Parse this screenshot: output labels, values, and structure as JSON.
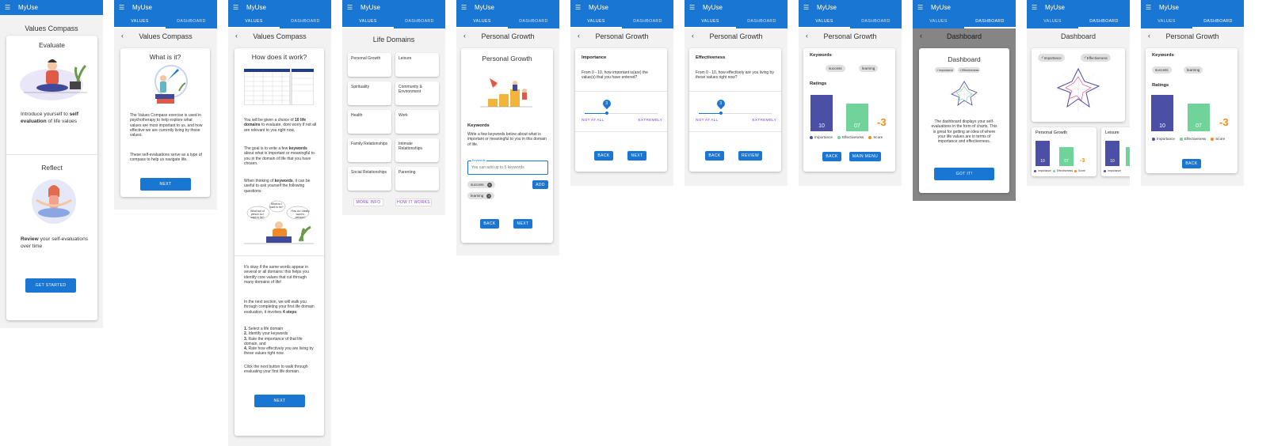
{
  "app_title": "MyUse",
  "tabs": {
    "values": "VALUES",
    "dashboard": "DASHBOARD"
  },
  "colors": {
    "primary": "#1976d2",
    "importance": "#4b4fa6",
    "effectiveness": "#6fd39a",
    "score": "#f28c18",
    "accent": "#7b3fbf"
  },
  "s1": {
    "title": "Values Compass",
    "evaluate_title": "Evaluate",
    "evaluate_pre": "Introduce yourself to ",
    "evaluate_bold": "self evaluation",
    "evaluate_post": " of life values",
    "reflect_title": "Reflect",
    "reflect_bold": "Review",
    "reflect_post": " your self-evaluations over time",
    "button": "GET STARTED"
  },
  "s2": {
    "title": "Values Compass",
    "card_title": "What is it?",
    "p1": "The Values Compass exercise is used in psychotherapy to help explore what values are most important to us, and how effective we are currently living by those values.",
    "p2": "These self-evaluations serve as a type of compass to help us navigate life.",
    "button": "NEXT"
  },
  "s3": {
    "title": "Values Compass",
    "card_title": "How does it work?",
    "p1_pre": "You will be given a choice of ",
    "p1_bold": "10 life domains",
    "p1_post": " to evaluate, dont worry if not all are relevant to you right now.",
    "p2_pre": "The goal is to write a few ",
    "p2_bold": "keywords",
    "p2_post": " about what is important or meaningful to you in the domain of life that you have chosen.",
    "p3_pre": "When thinking of ",
    "p3_bold": "keywords",
    "p3_post": ", it can be useful to ask yourself the following questions:",
    "bubbles": [
      "What do I want to be?",
      "What sort of person do I want to be?",
      "How do I ideally want to behave?"
    ],
    "p4": "It's okay if the same words appear in several or all domains: this helps you identify core values that cut through many domains of life!",
    "p5_pre": "In the next section, we will walk you through completing your first life domain evaluation, it involves ",
    "p5_bold": "4 steps",
    "p5_post": ":",
    "steps": [
      {
        "num": "1.",
        "text": " Select a life domain"
      },
      {
        "num": "2.",
        "text": " Identify your keywords"
      },
      {
        "num": "3.",
        "text": " Rate the importance of that life domain, and"
      },
      {
        "num": "4.",
        "text": " Rate how effectively you are living by these values right now."
      }
    ],
    "p6": "Click the next button to walk through evaluating your first life domain.",
    "button": "NEXT"
  },
  "s4": {
    "title": "Life Domains",
    "domains": [
      "Personal Growth",
      "Leisure",
      "Spirituality",
      "Community & Environment",
      "Health",
      "Work",
      "Family Relationships",
      "Intimate Relationships",
      "Social Relationships",
      "Parenting"
    ],
    "more_info": "MORE INFO",
    "how_it_works": "HOW IT WORKS"
  },
  "s5": {
    "title": "Personal Growth",
    "card_title": "Personal Growth",
    "keywords_label": "Keywords",
    "desc": "Write a few keywords below about what is important or meaningful to you in this domain of life.",
    "input_label": "Keywords",
    "input_placeholder": "You can add up to 5 keywords",
    "add": "ADD",
    "chips": [
      "success",
      "learning"
    ],
    "back": "BACK",
    "next": "NEXT"
  },
  "s6": {
    "title": "Personal Growth",
    "label": "Importance",
    "question": "From 0 - 10, how important is(are) the value(s) that you have entered?",
    "value": "3",
    "min_label": "NOT AT ALL",
    "max_label": "EXTREMELY",
    "level": 0.3,
    "back": "BACK",
    "next": "NEXT"
  },
  "s7": {
    "title": "Personal Growth",
    "label": "Effectiveness",
    "question": "From 0 - 10, how effectively are you living by these values right now?",
    "value": "3",
    "min_label": "NOT AT ALL",
    "max_label": "EXTREMELY",
    "level": 0.3,
    "back": "BACK",
    "review": "REVIEW"
  },
  "s8": {
    "title": "Personal Growth",
    "keywords_label": "Keywords",
    "chips": [
      "success",
      "learning"
    ],
    "ratings_label": "Ratings",
    "importance_value": "10",
    "effectiveness_value": "07",
    "score_value": "-3",
    "legend": [
      "Importance",
      "Effectiveness",
      "Score"
    ],
    "back": "BACK",
    "main_menu": "MAIN MENU"
  },
  "s9": {
    "title": "Dashboard",
    "card_title": "Dashboard",
    "legend": [
      "Importance",
      "Effectiveness"
    ],
    "text": "The dashboard displays your self-evaluations in the form of charts. This is great for getting an idea of where your life values are in terms of importance and effectiveness.",
    "button": "GOT IT!"
  },
  "s10": {
    "title": "Dashboard",
    "legend": [
      "Importance",
      "Effectiveness"
    ],
    "card1_title": "Personal Growth",
    "card1_imp": "10",
    "card1_eff": "07",
    "card1_score": "-3",
    "card2_title": "Leisure",
    "card2_imp": "10",
    "legend_small": [
      "Importance",
      "Effectiveness",
      "Score"
    ]
  },
  "s11": {
    "title": "Personal Growth",
    "keywords_label": "Keywords",
    "chips": [
      "success",
      "learning"
    ],
    "ratings_label": "Ratings",
    "importance_value": "10",
    "effectiveness_value": "07",
    "score_value": "-3",
    "legend": [
      "Importance",
      "Effectiveness",
      "Score"
    ],
    "back": "BACK"
  }
}
